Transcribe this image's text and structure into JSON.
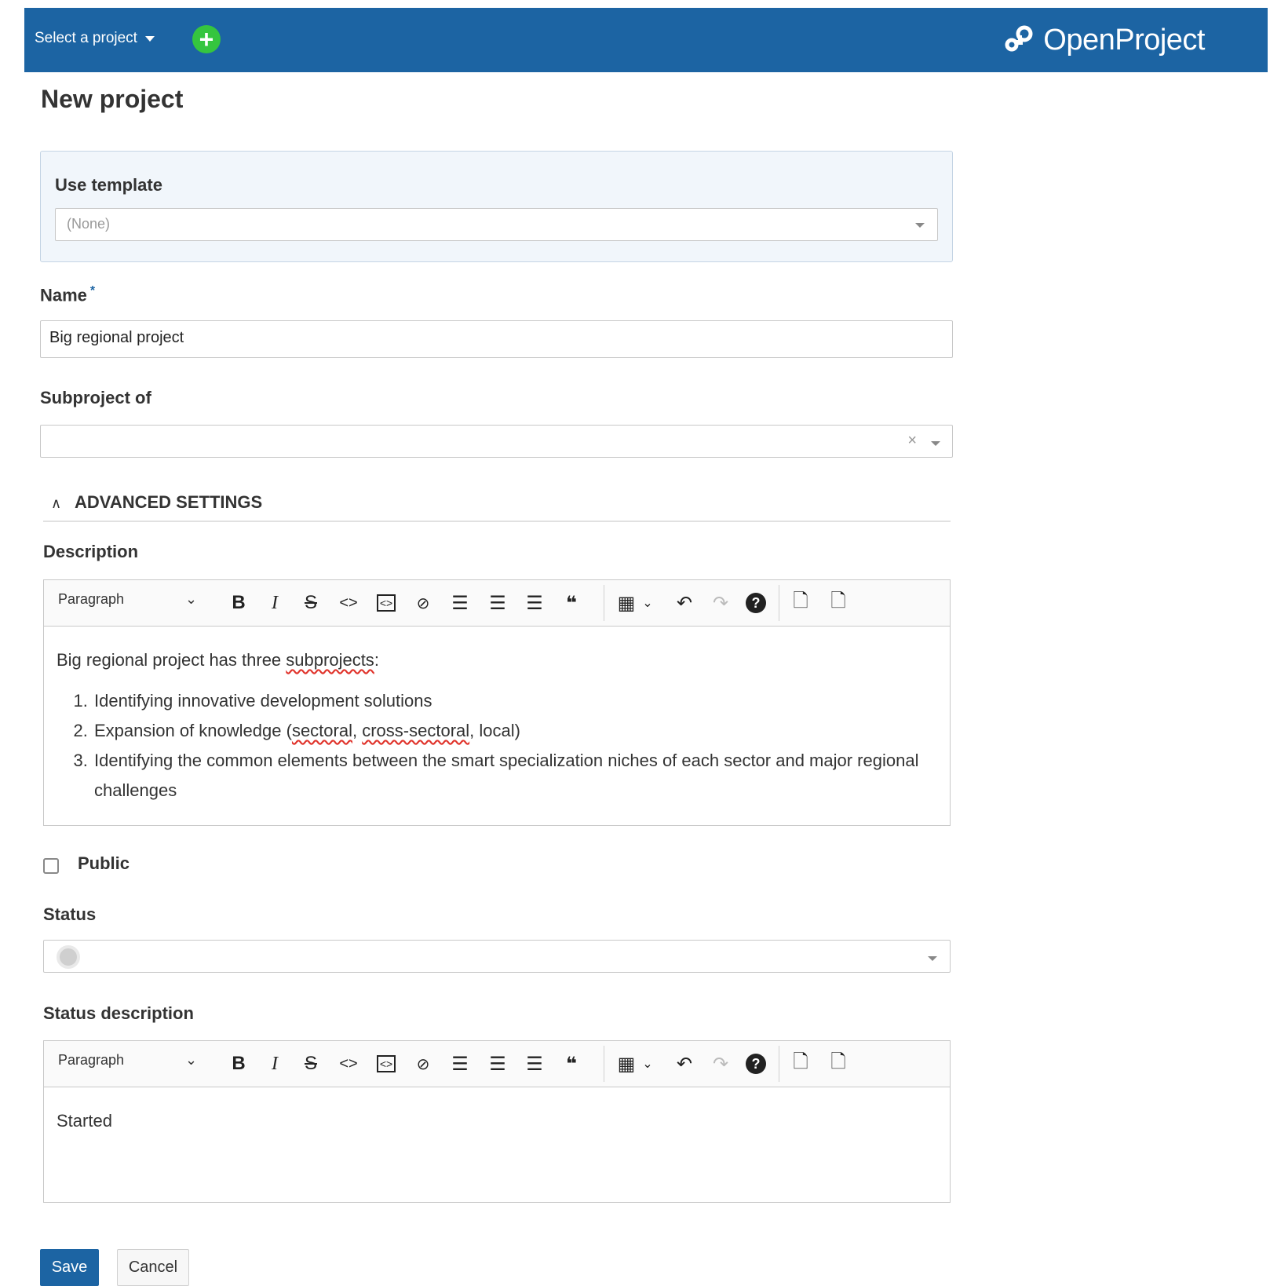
{
  "header": {
    "project_select": "Select a project",
    "add_label": "+",
    "logo_text": "OpenProject"
  },
  "page": {
    "title": "New project"
  },
  "template": {
    "label": "Use template",
    "value": "(None)"
  },
  "name": {
    "label": "Name",
    "required_mark": "*",
    "value": "Big regional project"
  },
  "subproject": {
    "label": "Subproject of",
    "value": "",
    "clear": "×"
  },
  "advanced": {
    "label": "ADVANCED SETTINGS",
    "chevron": "∧"
  },
  "description": {
    "label": "Description",
    "toolbar": {
      "paragraph": "Paragraph",
      "bold": "B",
      "italic": "I",
      "strike": "S",
      "code": "<>",
      "code_block": "<>",
      "link": "🔗",
      "quote": "❝",
      "undo": "↶",
      "redo": "↷",
      "help": "?"
    },
    "intro_prefix": "Big regional project has three ",
    "intro_word": "subprojects",
    "intro_suffix": ":",
    "items": [
      "Identifying innovative development solutions",
      "Expansion of knowledge (",
      "Identifying the common elements between the smart specialization niches of each sector and major regional challenges"
    ],
    "item2_w1": "sectoral",
    "item2_sep": ", ",
    "item2_w2": "cross-sectoral",
    "item2_suffix": ", local)"
  },
  "public": {
    "label": "Public",
    "checked": false
  },
  "status": {
    "label": "Status",
    "value": ""
  },
  "status_description": {
    "label": "Status description",
    "value": "Started"
  },
  "buttons": {
    "save": "Save",
    "cancel": "Cancel"
  },
  "colors": {
    "header": "#1c64a3",
    "accent_green": "#35c53f",
    "primary": "#1c64a3"
  }
}
